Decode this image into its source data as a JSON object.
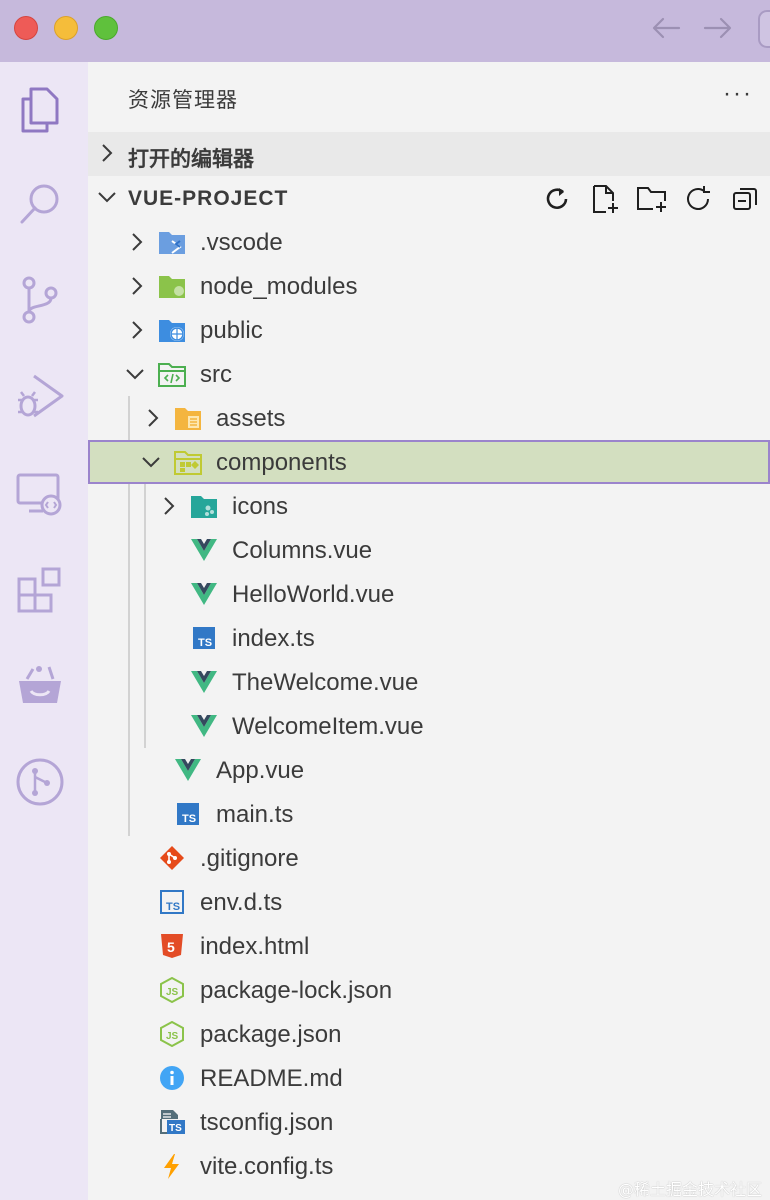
{
  "titlebar": {
    "back_icon": "arrow-left-icon",
    "forward_icon": "arrow-right-icon"
  },
  "activity_bar": {
    "items": [
      "explorer-icon",
      "search-icon",
      "source-control-icon",
      "run-debug-icon",
      "remote-explorer-icon",
      "extensions-icon",
      "basket-icon",
      "git-graph-icon"
    ]
  },
  "sidebar": {
    "title": "资源管理器",
    "more": "···",
    "open_editors": "打开的编辑器",
    "project": "VUE-PROJECT",
    "tree": [
      {
        "name": ".vscode",
        "icon": "vscode-folder-icon"
      },
      {
        "name": "node_modules",
        "icon": "node-folder-icon"
      },
      {
        "name": "public",
        "icon": "public-folder-icon"
      },
      {
        "name": "src",
        "icon": "src-folder-icon"
      },
      {
        "name": "assets",
        "icon": "assets-folder-icon"
      },
      {
        "name": "components",
        "icon": "components-folder-icon"
      },
      {
        "name": "icons",
        "icon": "icons-folder-icon"
      },
      {
        "name": "Columns.vue",
        "icon": "vue-icon"
      },
      {
        "name": "HelloWorld.vue",
        "icon": "vue-icon"
      },
      {
        "name": "index.ts",
        "icon": "typescript-icon"
      },
      {
        "name": "TheWelcome.vue",
        "icon": "vue-icon"
      },
      {
        "name": "WelcomeItem.vue",
        "icon": "vue-icon"
      },
      {
        "name": "App.vue",
        "icon": "vue-icon"
      },
      {
        "name": "main.ts",
        "icon": "typescript-icon"
      },
      {
        "name": ".gitignore",
        "icon": "git-icon"
      },
      {
        "name": "env.d.ts",
        "icon": "typescript-def-icon"
      },
      {
        "name": "index.html",
        "icon": "html5-icon"
      },
      {
        "name": "package-lock.json",
        "icon": "nodejs-icon"
      },
      {
        "name": "package.json",
        "icon": "nodejs-icon"
      },
      {
        "name": "README.md",
        "icon": "info-icon"
      },
      {
        "name": "tsconfig.json",
        "icon": "tsconfig-icon"
      },
      {
        "name": "vite.config.ts",
        "icon": "vite-icon"
      }
    ]
  },
  "colors": {
    "titlebar": "#c6b9dc",
    "activity_bar": "#ece6f5",
    "activity_icon": "#a08cc8",
    "selected_row": "#d3dfc0",
    "selected_border": "#9b84cc",
    "vue_green": "#41b883",
    "vue_dark": "#35495e",
    "ts_blue": "#3178c6"
  },
  "watermark": "@稀土掘金技术社区"
}
